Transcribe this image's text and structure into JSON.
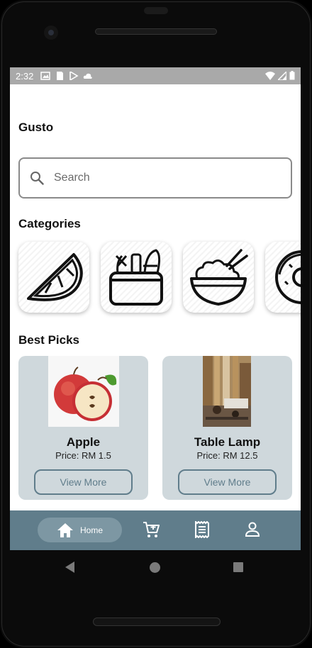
{
  "status_bar": {
    "time": "2:32",
    "left_icons": [
      "image-icon",
      "sd-card-icon",
      "play-store-icon",
      "cloud-icon"
    ],
    "right_icons": [
      "wifi-icon",
      "signal-icon",
      "battery-icon"
    ]
  },
  "app": {
    "title": "Gusto"
  },
  "search": {
    "placeholder": "Search",
    "value": ""
  },
  "categories": {
    "title": "Categories",
    "items": [
      {
        "icon": "orange-slice-icon"
      },
      {
        "icon": "grocery-basket-icon"
      },
      {
        "icon": "rice-bowl-icon"
      },
      {
        "icon": "donut-icon"
      }
    ]
  },
  "best_picks": {
    "title": "Best Picks",
    "items": [
      {
        "name": "Apple",
        "price": "Price: RM 1.5",
        "button": "View More",
        "image": "apple-photo"
      },
      {
        "name": "Table Lamp",
        "price": "Price: RM 12.5",
        "button": "View More",
        "image": "cafe-interior-photo"
      }
    ]
  },
  "bottom_nav": {
    "home_label": "Home",
    "items": [
      "home-icon",
      "cart-icon",
      "receipt-icon",
      "profile-icon"
    ]
  },
  "colors": {
    "accent": "#607d8b",
    "card_bg": "#cfd8dc",
    "status_bar": "#a9a9a9"
  }
}
